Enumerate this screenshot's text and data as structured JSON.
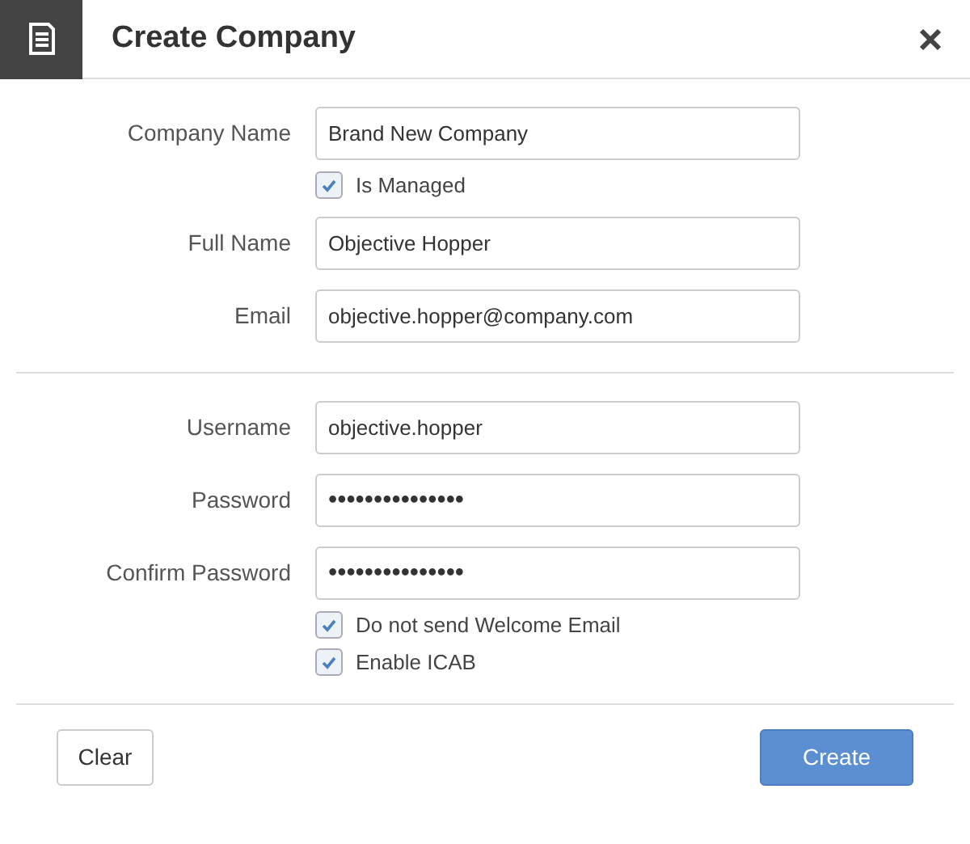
{
  "dialog": {
    "title": "Create Company"
  },
  "sections": [
    {
      "rows": [
        {
          "kind": "field",
          "label": "Company Name",
          "value": "Brand New Company"
        },
        {
          "kind": "checkbox",
          "label": "Is Managed",
          "checked": true
        },
        {
          "kind": "field",
          "label": "Full Name",
          "value": "Objective Hopper"
        },
        {
          "kind": "field",
          "label": "Email",
          "value": "objective.hopper@company.com"
        }
      ]
    },
    {
      "rows": [
        {
          "kind": "field",
          "label": "Username",
          "value": "objective.hopper"
        },
        {
          "kind": "field",
          "label": "Password",
          "value": "•••••••••••••••"
        },
        {
          "kind": "field",
          "label": "Confirm Password",
          "value": "•••••••••••••••"
        },
        {
          "kind": "checkbox",
          "label": "Do not send Welcome Email",
          "checked": true
        },
        {
          "kind": "checkbox",
          "label": "Enable ICAB",
          "checked": true
        }
      ]
    }
  ],
  "buttons": [
    {
      "label": "Clear",
      "kind": "secondary"
    },
    {
      "label": "Create",
      "kind": "primary"
    }
  ]
}
